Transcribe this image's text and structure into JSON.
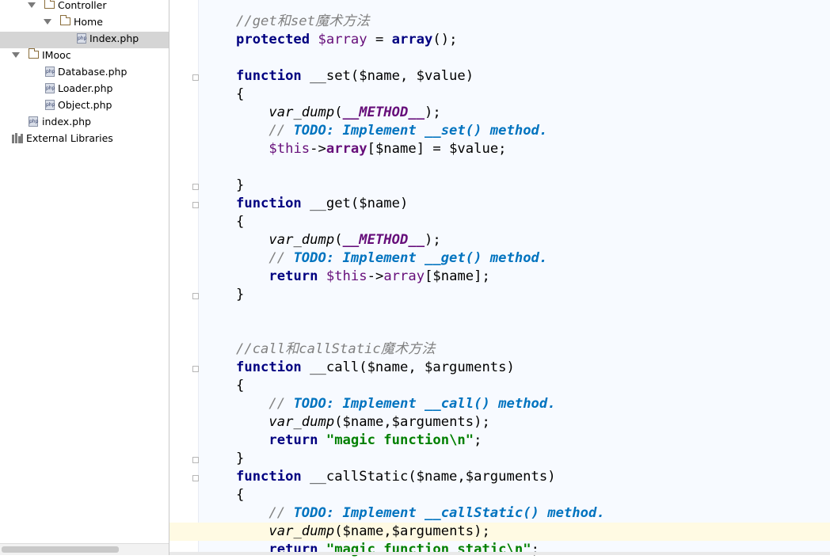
{
  "sidebar": {
    "items": [
      {
        "label": "Controller",
        "kind": "folder"
      },
      {
        "label": "Home",
        "kind": "folder"
      },
      {
        "label": "Index.php",
        "kind": "php",
        "selected": true
      },
      {
        "label": "IMooc",
        "kind": "folder"
      },
      {
        "label": "Database.php",
        "kind": "php"
      },
      {
        "label": "Loader.php",
        "kind": "php"
      },
      {
        "label": "Object.php",
        "kind": "php"
      },
      {
        "label": "index.php",
        "kind": "php"
      },
      {
        "label": "External Libraries",
        "kind": "libraries"
      }
    ],
    "php_icon_text": "php"
  },
  "editor": {
    "lines": [
      {
        "tokens": [
          {
            "t": "cmt",
            "v": "//get和set魔术方法"
          }
        ]
      },
      {
        "tokens": [
          {
            "t": "kw",
            "v": "protected"
          },
          {
            "t": "plain",
            "v": " "
          },
          {
            "t": "var",
            "v": "$array"
          },
          {
            "t": "plain",
            "v": " = "
          },
          {
            "t": "kw",
            "v": "array"
          },
          {
            "t": "plain",
            "v": "();"
          }
        ]
      },
      {
        "tokens": []
      },
      {
        "tokens": [
          {
            "t": "kw",
            "v": "function"
          },
          {
            "t": "plain",
            "v": " __set($name, $value)"
          }
        ]
      },
      {
        "tokens": [
          {
            "t": "plain",
            "v": "{"
          }
        ]
      },
      {
        "tokens": [
          {
            "t": "plain",
            "v": "    "
          },
          {
            "t": "fn",
            "v": "var_dump"
          },
          {
            "t": "plain",
            "v": "("
          },
          {
            "t": "magic",
            "v": "__METHOD__"
          },
          {
            "t": "plain",
            "v": ");"
          }
        ]
      },
      {
        "tokens": [
          {
            "t": "plain",
            "v": "    "
          },
          {
            "t": "cmt",
            "v": "// "
          },
          {
            "t": "todo",
            "v": "TODO: Implement __set() method."
          }
        ]
      },
      {
        "tokens": [
          {
            "t": "plain",
            "v": "    "
          },
          {
            "t": "var",
            "v": "$this"
          },
          {
            "t": "plain",
            "v": "->"
          },
          {
            "t": "prop",
            "v": "array"
          },
          {
            "t": "plain",
            "v": "[$name] = $value;"
          }
        ]
      },
      {
        "tokens": []
      },
      {
        "tokens": [
          {
            "t": "plain",
            "v": "}"
          }
        ]
      },
      {
        "tokens": [
          {
            "t": "kw",
            "v": "function"
          },
          {
            "t": "plain",
            "v": " __get($name)"
          }
        ]
      },
      {
        "tokens": [
          {
            "t": "plain",
            "v": "{"
          }
        ]
      },
      {
        "tokens": [
          {
            "t": "plain",
            "v": "    "
          },
          {
            "t": "fn",
            "v": "var_dump"
          },
          {
            "t": "plain",
            "v": "("
          },
          {
            "t": "magic",
            "v": "__METHOD__"
          },
          {
            "t": "plain",
            "v": ");"
          }
        ]
      },
      {
        "tokens": [
          {
            "t": "plain",
            "v": "    "
          },
          {
            "t": "cmt",
            "v": "// "
          },
          {
            "t": "todo",
            "v": "TODO: Implement __get() method."
          }
        ]
      },
      {
        "tokens": [
          {
            "t": "plain",
            "v": "    "
          },
          {
            "t": "kw",
            "v": "return"
          },
          {
            "t": "plain",
            "v": " "
          },
          {
            "t": "var",
            "v": "$this"
          },
          {
            "t": "plain",
            "v": "->"
          },
          {
            "t": "var",
            "v": "array"
          },
          {
            "t": "plain",
            "v": "[$name];"
          }
        ]
      },
      {
        "tokens": [
          {
            "t": "plain",
            "v": "}"
          }
        ]
      },
      {
        "tokens": []
      },
      {
        "tokens": []
      },
      {
        "tokens": [
          {
            "t": "cmt",
            "v": "//call和callStatic魔术方法"
          }
        ]
      },
      {
        "tokens": [
          {
            "t": "kw",
            "v": "function"
          },
          {
            "t": "plain",
            "v": " __call($name, $arguments)"
          }
        ]
      },
      {
        "tokens": [
          {
            "t": "plain",
            "v": "{"
          }
        ]
      },
      {
        "tokens": [
          {
            "t": "plain",
            "v": "    "
          },
          {
            "t": "cmt",
            "v": "// "
          },
          {
            "t": "todo",
            "v": "TODO: Implement __call() method."
          }
        ]
      },
      {
        "tokens": [
          {
            "t": "plain",
            "v": "    "
          },
          {
            "t": "fn",
            "v": "var_dump"
          },
          {
            "t": "plain",
            "v": "($name,$arguments);"
          }
        ]
      },
      {
        "tokens": [
          {
            "t": "plain",
            "v": "    "
          },
          {
            "t": "kw",
            "v": "return"
          },
          {
            "t": "plain",
            "v": " "
          },
          {
            "t": "str",
            "v": "\"magic function\\n\""
          },
          {
            "t": "plain",
            "v": ";"
          }
        ]
      },
      {
        "tokens": [
          {
            "t": "plain",
            "v": "}"
          }
        ]
      },
      {
        "tokens": [
          {
            "t": "kw",
            "v": "function"
          },
          {
            "t": "plain",
            "v": " __callStatic($name,$arguments)"
          }
        ]
      },
      {
        "tokens": [
          {
            "t": "plain",
            "v": "{"
          }
        ]
      },
      {
        "tokens": [
          {
            "t": "plain",
            "v": "    "
          },
          {
            "t": "cmt",
            "v": "// "
          },
          {
            "t": "todo",
            "v": "TODO: Implement __callStatic() method."
          }
        ]
      },
      {
        "tokens": [
          {
            "t": "plain",
            "v": "    "
          },
          {
            "t": "fn",
            "v": "var_dump"
          },
          {
            "t": "plain",
            "v": "($name,$arguments);"
          }
        ]
      },
      {
        "tokens": [
          {
            "t": "plain",
            "v": "    "
          },
          {
            "t": "kw",
            "v": "return"
          },
          {
            "t": "plain",
            "v": " "
          },
          {
            "t": "str",
            "v": "\"magic function static\\n\""
          },
          {
            "t": "plain",
            "v": ";"
          }
        ]
      }
    ]
  },
  "colors": {
    "keyword": "#000080",
    "variable": "#660e7a",
    "comment": "#808080",
    "todo": "#0073bf",
    "string": "#008000",
    "caret_line": "#fffae3",
    "selection": "#d5d5d5"
  }
}
